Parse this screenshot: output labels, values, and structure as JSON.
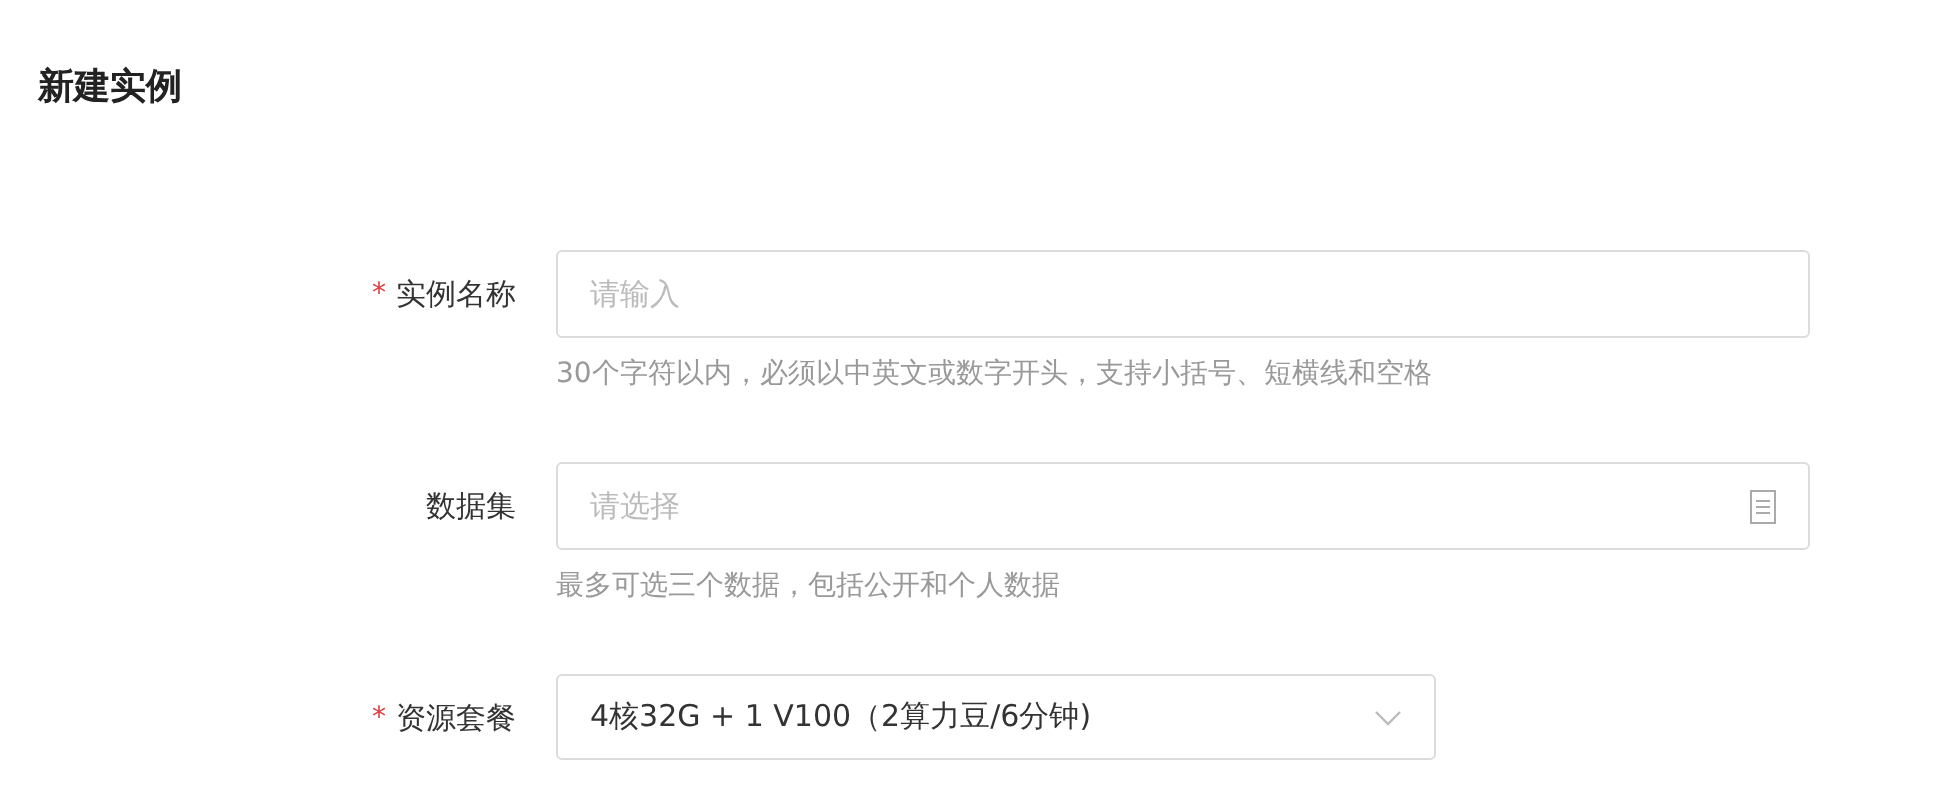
{
  "title": "新建实例",
  "required_symbol": "*",
  "fields": [
    {
      "kind": "text",
      "label": "实例名称",
      "required": true,
      "placeholder": "请输入",
      "hint": "30个字符以内，必须以中英文或数字开头，支持小括号、短横线和空格"
    },
    {
      "kind": "picker",
      "label": "数据集",
      "required": false,
      "placeholder": "请选择",
      "hint": "最多可选三个数据，包括公开和个人数据"
    },
    {
      "kind": "select",
      "label": "资源套餐",
      "required": true,
      "value": "4核32G + 1 V100（2算力豆/6分钟)"
    }
  ]
}
